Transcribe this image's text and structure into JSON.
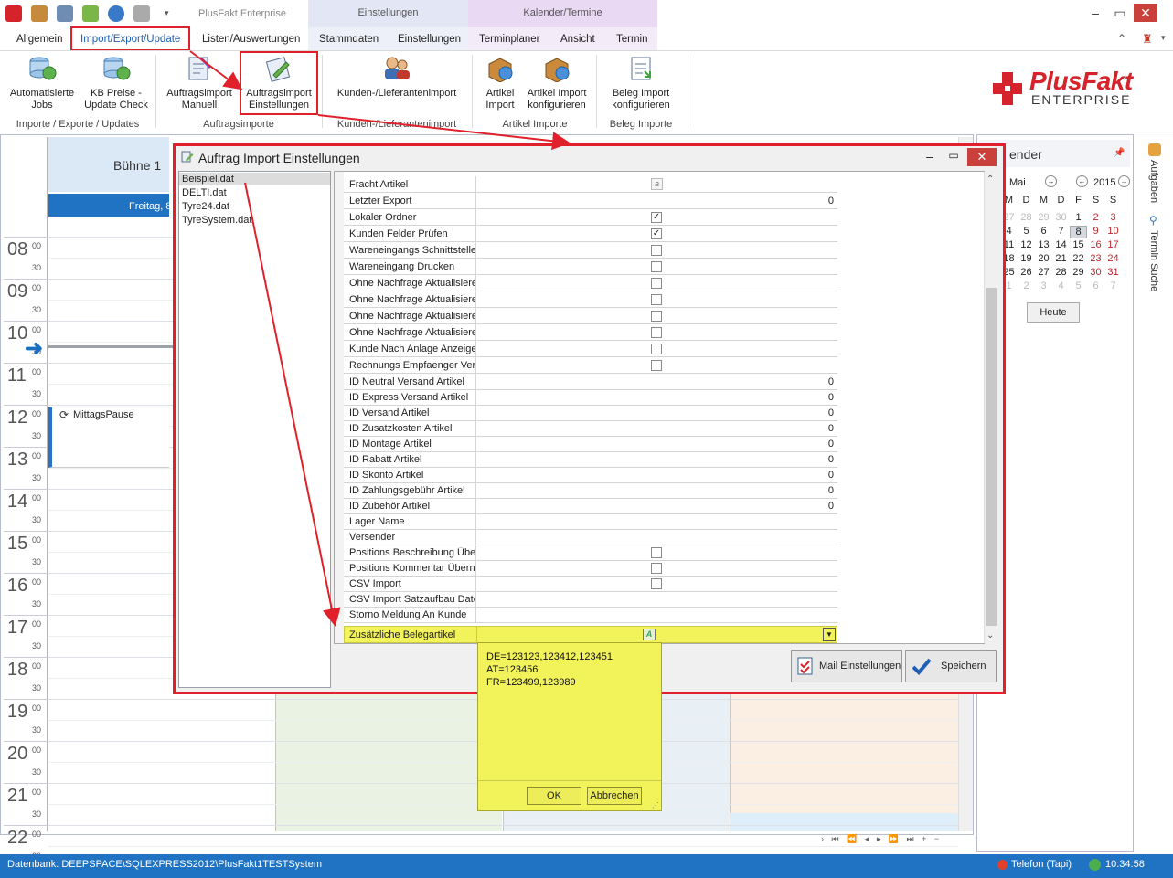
{
  "app": {
    "title": "PlusFakt Enterprise",
    "context_einstellungen": "Einstellungen",
    "context_kalender": "Kalender/Termine"
  },
  "tabs": {
    "allgemein": "Allgemein",
    "import_export": "Import/Export/Update",
    "listen": "Listen/Auswertungen",
    "stammdaten": "Stammdaten",
    "einstellungen": "Einstellungen",
    "terminplaner": "Terminplaner",
    "ansicht": "Ansicht",
    "termin": "Termin"
  },
  "ribbon": {
    "auto_jobs_1": "Automatisierte",
    "auto_jobs_2": "Jobs",
    "kb_preise_1": "KB Preise -",
    "kb_preise_2": "Update Check",
    "ai_manuell_1": "Auftragsimport",
    "ai_manuell_2": "Manuell",
    "ai_einst_1": "Auftragsimport",
    "ai_einst_2": "Einstellungen",
    "kunden_import": "Kunden-/Lieferantenimport",
    "artikel_import_1": "Artikel",
    "artikel_import_2": "Import",
    "artikel_konf_1": "Artikel Import",
    "artikel_konf_2": "konfigurieren",
    "beleg_konf_1": "Beleg Import",
    "beleg_konf_2": "konfigurieren",
    "grp_importe": "Importe / Exporte / Updates",
    "grp_auftrag": "Auftragsimporte",
    "grp_kunden": "Kunden-/Lieferantenimport",
    "grp_artikel": "Artikel Importe",
    "grp_beleg": "Beleg Importe"
  },
  "logo": {
    "line1": "PlusFakt",
    "line2": "ENTERPRISE"
  },
  "calendar": {
    "resource": "Bühne 1",
    "day": "Freitag, 8",
    "minute_zero": "00",
    "minute_half": "30",
    "hours": [
      "08",
      "09",
      "10",
      "11",
      "12",
      "13",
      "14",
      "15",
      "16",
      "17",
      "18",
      "19",
      "20",
      "21",
      "22"
    ],
    "appointment": "MittagsPause"
  },
  "mini_calendar": {
    "title": "ender",
    "month": "Mai",
    "year": "2015",
    "weekdays": [
      "M",
      "D",
      "M",
      "D",
      "F",
      "S",
      "S"
    ],
    "weeks": [
      [
        "27",
        "28",
        "29",
        "30",
        "1",
        "2",
        "3"
      ],
      [
        "4",
        "5",
        "6",
        "7",
        "8",
        "9",
        "10"
      ],
      [
        "11",
        "12",
        "13",
        "14",
        "15",
        "16",
        "17"
      ],
      [
        "18",
        "19",
        "20",
        "21",
        "22",
        "23",
        "24"
      ],
      [
        "25",
        "26",
        "27",
        "28",
        "29",
        "30",
        "31"
      ],
      [
        "1",
        "2",
        "3",
        "4",
        "5",
        "6",
        "7"
      ]
    ],
    "today_button": "Heute"
  },
  "side_tabs": {
    "aufgaben": "Aufgaben",
    "termin_suche": "Termin Suche"
  },
  "dialog": {
    "title": "Auftrag Import Einstellungen",
    "files": [
      "Beispiel.dat",
      "DELTI.dat",
      "Tyre24.dat",
      "TyreSystem.dat"
    ],
    "rows": [
      {
        "name": "Fracht Artikel",
        "kind": "edit",
        "value": ""
      },
      {
        "name": "Letzter Export",
        "kind": "num",
        "value": "0"
      },
      {
        "name": "Lokaler Ordner",
        "kind": "chk",
        "value": "checked"
      },
      {
        "name": "Kunden Felder Prüfen",
        "kind": "chk",
        "value": "checked"
      },
      {
        "name": "Wareneingangs Schnittstelle",
        "kind": "chk",
        "value": ""
      },
      {
        "name": "Wareneingang Drucken",
        "kind": "chk",
        "value": ""
      },
      {
        "name": "Ohne Nachfrage Aktualisieren",
        "kind": "chk",
        "value": ""
      },
      {
        "name": "Ohne Nachfrage Aktualisieren",
        "kind": "chk",
        "value": ""
      },
      {
        "name": "Ohne Nachfrage Aktualisieren",
        "kind": "chk",
        "value": ""
      },
      {
        "name": "Ohne Nachfrage Aktualisieren",
        "kind": "chk",
        "value": ""
      },
      {
        "name": "Kunde Nach Anlage Anzeigen",
        "kind": "chk",
        "value": ""
      },
      {
        "name": "Rechnungs Empfaenger Verwenden",
        "kind": "chk",
        "value": ""
      },
      {
        "name": "ID Neutral Versand Artikel",
        "kind": "num",
        "value": "0"
      },
      {
        "name": "ID Express Versand Artikel",
        "kind": "num",
        "value": "0"
      },
      {
        "name": "ID Versand Artikel",
        "kind": "num",
        "value": "0"
      },
      {
        "name": "ID Zusatzkosten Artikel",
        "kind": "num",
        "value": "0"
      },
      {
        "name": "ID Montage Artikel",
        "kind": "num",
        "value": "0"
      },
      {
        "name": "ID Rabatt Artikel",
        "kind": "num",
        "value": "0"
      },
      {
        "name": "ID Skonto Artikel",
        "kind": "num",
        "value": "0"
      },
      {
        "name": "ID Zahlungsgebühr Artikel",
        "kind": "num",
        "value": "0"
      },
      {
        "name": "ID Zubehör Artikel",
        "kind": "num",
        "value": "0"
      },
      {
        "name": "Lager Name",
        "kind": "text",
        "value": ""
      },
      {
        "name": "Versender",
        "kind": "text",
        "value": ""
      },
      {
        "name": "Positions Beschreibung Übernehmen",
        "kind": "chk",
        "value": ""
      },
      {
        "name": "Positions Kommentar Übernehmen",
        "kind": "chk",
        "value": ""
      },
      {
        "name": "CSV Import",
        "kind": "chk",
        "value": ""
      },
      {
        "name": "CSV Import Satzaufbau Datei",
        "kind": "text",
        "value": ""
      },
      {
        "name": "Storno Meldung An Kunde",
        "kind": "text",
        "value": ""
      }
    ],
    "highlight_row": "Zusätzliche Belegartikel",
    "memo_text": "DE=123123,123412,123451\nAT=123456\nFR=123499,123989",
    "memo_ok": "OK",
    "memo_cancel": "Abbrechen",
    "mail_button": "Mail Einstellungen",
    "save_button": "Speichern"
  },
  "status": {
    "database": "Datenbank: DEEPSPACE\\SQLEXPRESS2012\\PlusFakt1TESTSystem",
    "phone": "Telefon (Tapi)",
    "time": "10:34:58"
  },
  "colors": {
    "accent": "#1f73c2",
    "annotation_red": "#e0202a",
    "highlight_yellow": "#f2f25a"
  }
}
